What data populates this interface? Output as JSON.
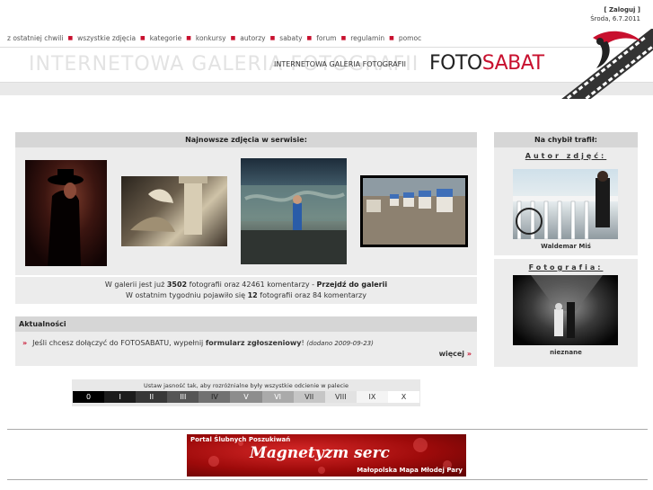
{
  "top": {
    "login": "[ Zaloguj ]",
    "date": "Środa, 6.7.2011"
  },
  "nav": [
    "z ostatniej chwili",
    "wszystkie zdjęcia",
    "kategorie",
    "konkursy",
    "autorzy",
    "sabaty",
    "forum",
    "regulamin",
    "pomoc"
  ],
  "banner": {
    "ghost": "INTERNETOWA GALERIA FOTOGRAFII",
    "subtitle": "INTERNETOWA GALERIA FOTOGRAFII",
    "logo_a": "FOTO",
    "logo_b": "SABAT"
  },
  "latest": {
    "title": "Najnowsze zdjęcia w serwisie:",
    "line1_a": "W galerii jest już ",
    "photos": "3502",
    "line1_b": " fotografii oraz 42461 komentarzy - ",
    "go_link": "Przejdź do galerii",
    "line2_a": "W ostatnim tygodniu pojawiło się ",
    "week_photos": "12",
    "line2_b": " fotografii oraz 84 komentarzy"
  },
  "news": {
    "title": "Aktualności",
    "arrow": "»",
    "text_a": "Jeśli chcesz dołączyć do FOTOSABATU, wypełnij ",
    "form_link": "formularz zgłoszeniowy",
    "text_b": "! ",
    "added": "(dodano 2009-09-23)",
    "more": "więcej"
  },
  "palette": {
    "title": "Ustaw jasność tak, aby rozróżnialne były wszystkie odcienie w palecie",
    "cells": [
      {
        "label": "0",
        "bg": "#000000",
        "fg": "#ffffff"
      },
      {
        "label": "I",
        "bg": "#1c1c1c",
        "fg": "#ffffff"
      },
      {
        "label": "II",
        "bg": "#383838",
        "fg": "#ffffff"
      },
      {
        "label": "III",
        "bg": "#555555",
        "fg": "#ffffff"
      },
      {
        "label": "IV",
        "bg": "#717171",
        "fg": "#222222"
      },
      {
        "label": "V",
        "bg": "#8d8d8d",
        "fg": "#ffffff"
      },
      {
        "label": "VI",
        "bg": "#aaaaaa",
        "fg": "#ffffff"
      },
      {
        "label": "VII",
        "bg": "#c6c6c6",
        "fg": "#333333"
      },
      {
        "label": "VIII",
        "bg": "#e2e2e2",
        "fg": "#333333"
      },
      {
        "label": "IX",
        "bg": "#f4f4f4",
        "fg": "#333333"
      },
      {
        "label": "X",
        "bg": "#ffffff",
        "fg": "#333333"
      }
    ]
  },
  "side": {
    "title": "Na chybił trafił:",
    "author_label": "Autor zdjęć:",
    "author_name": "Waldemar Miś",
    "photo_label": "Fotografia:",
    "photo_name": "nieznane"
  },
  "ad": {
    "top": "Portal Ślubnych Poszukiwań",
    "main": "Magnetyzm serc",
    "sub": "Małopolska Mapa Młodej Pary"
  },
  "colors": {
    "accent": "#c8102e",
    "panel": "#ececec",
    "panel_head": "#d6d6d6"
  }
}
